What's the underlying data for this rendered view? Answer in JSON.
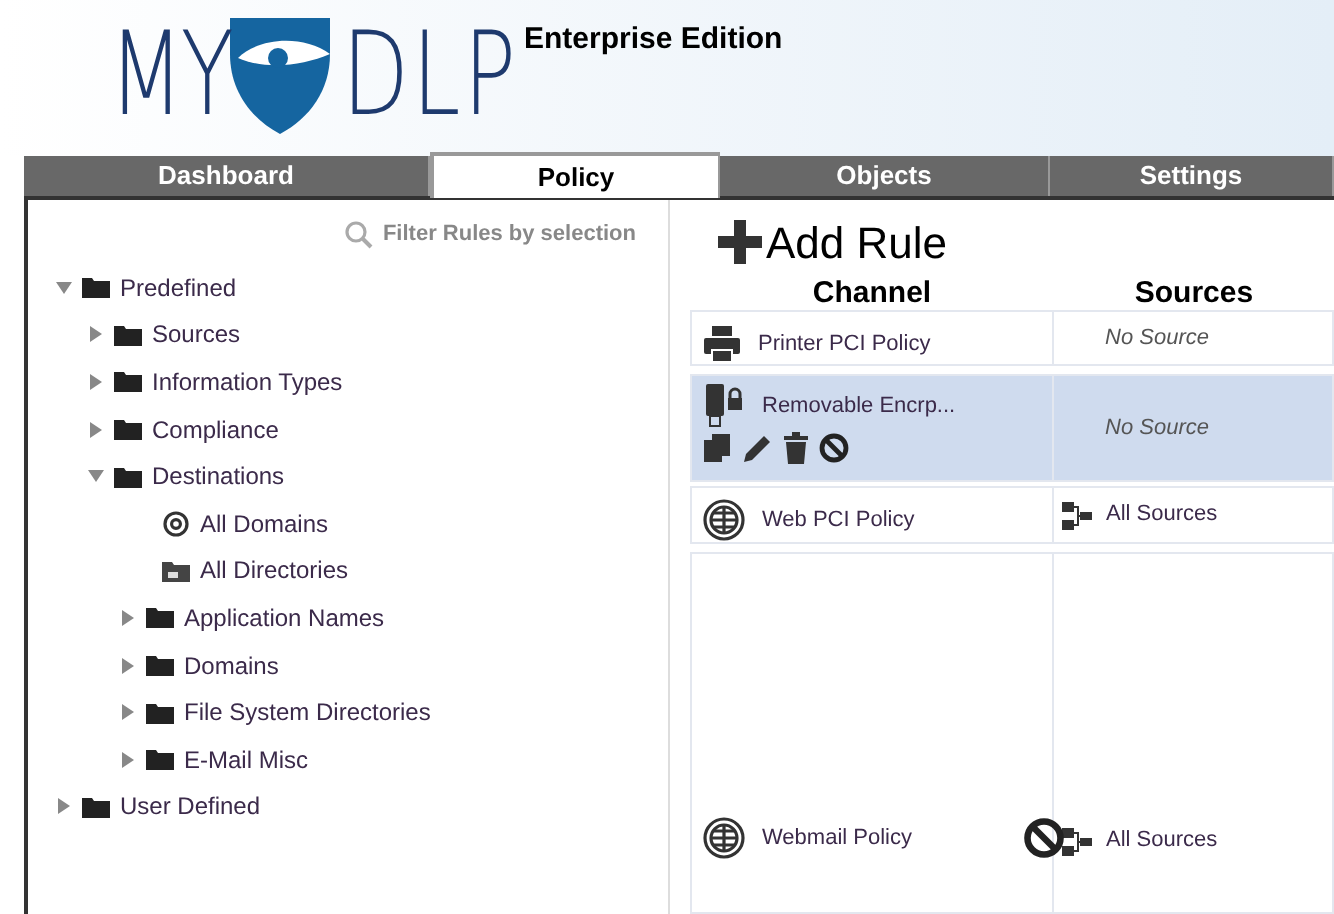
{
  "header": {
    "logo_left": "MY",
    "logo_right": "DLP",
    "edition": "Enterprise Edition"
  },
  "tabs": [
    {
      "label": "Dashboard",
      "selected": false
    },
    {
      "label": "Policy",
      "selected": true
    },
    {
      "label": "Objects",
      "selected": false
    },
    {
      "label": "Settings",
      "selected": false
    }
  ],
  "filter": {
    "label": "Filter Rules by selection"
  },
  "tree": [
    {
      "label": "Predefined",
      "kind": "folder",
      "expanded": true,
      "children": [
        {
          "label": "Sources",
          "kind": "folder",
          "expanded": false
        },
        {
          "label": "Information Types",
          "kind": "folder",
          "expanded": false
        },
        {
          "label": "Compliance",
          "kind": "folder",
          "expanded": false
        },
        {
          "label": "Destinations",
          "kind": "folder",
          "expanded": true,
          "children": [
            {
              "label": "All Domains",
              "kind": "at"
            },
            {
              "label": "All Directories",
              "kind": "fs"
            },
            {
              "label": "Application Names",
              "kind": "folder",
              "expanded": false
            },
            {
              "label": "Domains",
              "kind": "folder",
              "expanded": false
            },
            {
              "label": "File System Directories",
              "kind": "folder",
              "expanded": false
            },
            {
              "label": "E-Mail Misc",
              "kind": "folder",
              "expanded": false
            }
          ]
        }
      ]
    },
    {
      "label": "User Defined",
      "kind": "folder",
      "expanded": false
    }
  ],
  "add_rule": {
    "label": "Add Rule"
  },
  "table": {
    "columns": [
      "Channel",
      "Sources"
    ],
    "rows": [
      {
        "kind": "printer",
        "name": "Printer PCI Policy",
        "source": {
          "kind": "none",
          "text": "No Source"
        },
        "selected": false,
        "blocked": false
      },
      {
        "kind": "usb",
        "name": "Removable Encrp...",
        "source": {
          "kind": "none",
          "text": "No Source"
        },
        "selected": true,
        "blocked": false
      },
      {
        "kind": "web",
        "name": "Web PCI Policy",
        "source": {
          "kind": "all",
          "text": "All Sources"
        },
        "selected": false,
        "blocked": false
      },
      {
        "kind": "web",
        "name": "Webmail Policy",
        "source": {
          "kind": "all",
          "text": "All Sources"
        },
        "selected": false,
        "blocked": true
      }
    ]
  }
}
